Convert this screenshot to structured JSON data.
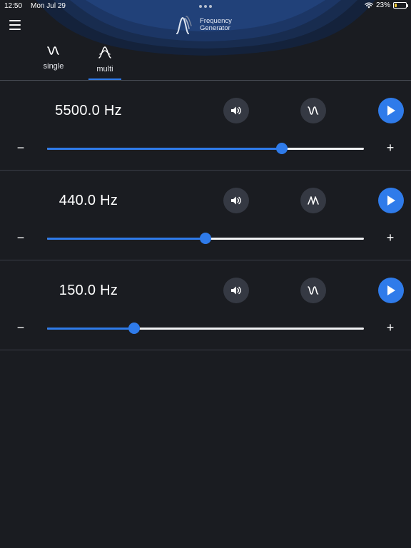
{
  "status_bar": {
    "time": "12:50",
    "date": "Mon Jul 29",
    "battery_text": "23%",
    "battery_level": 0.23
  },
  "app": {
    "title_line1": "Frequency",
    "title_line2": "Generator"
  },
  "tabs": [
    {
      "label": "single",
      "icon": "sine-wave-icon",
      "active": false
    },
    {
      "label": "multi",
      "icon": "multi-wave-icon",
      "active": true
    }
  ],
  "generators": [
    {
      "frequency": "5500.0 Hz",
      "waveform": "sine",
      "level": 0.742
    },
    {
      "frequency": "440.0 Hz",
      "waveform": "sawtooth",
      "level": 0.5
    },
    {
      "frequency": "150.0 Hz",
      "waveform": "sine",
      "level": 0.275
    }
  ],
  "labels": {
    "minus": "−",
    "plus": "+"
  },
  "colors": {
    "accent": "#2f7bea",
    "background": "#1a1c21",
    "button_bg": "#353943",
    "battery": "#f5cd33"
  }
}
